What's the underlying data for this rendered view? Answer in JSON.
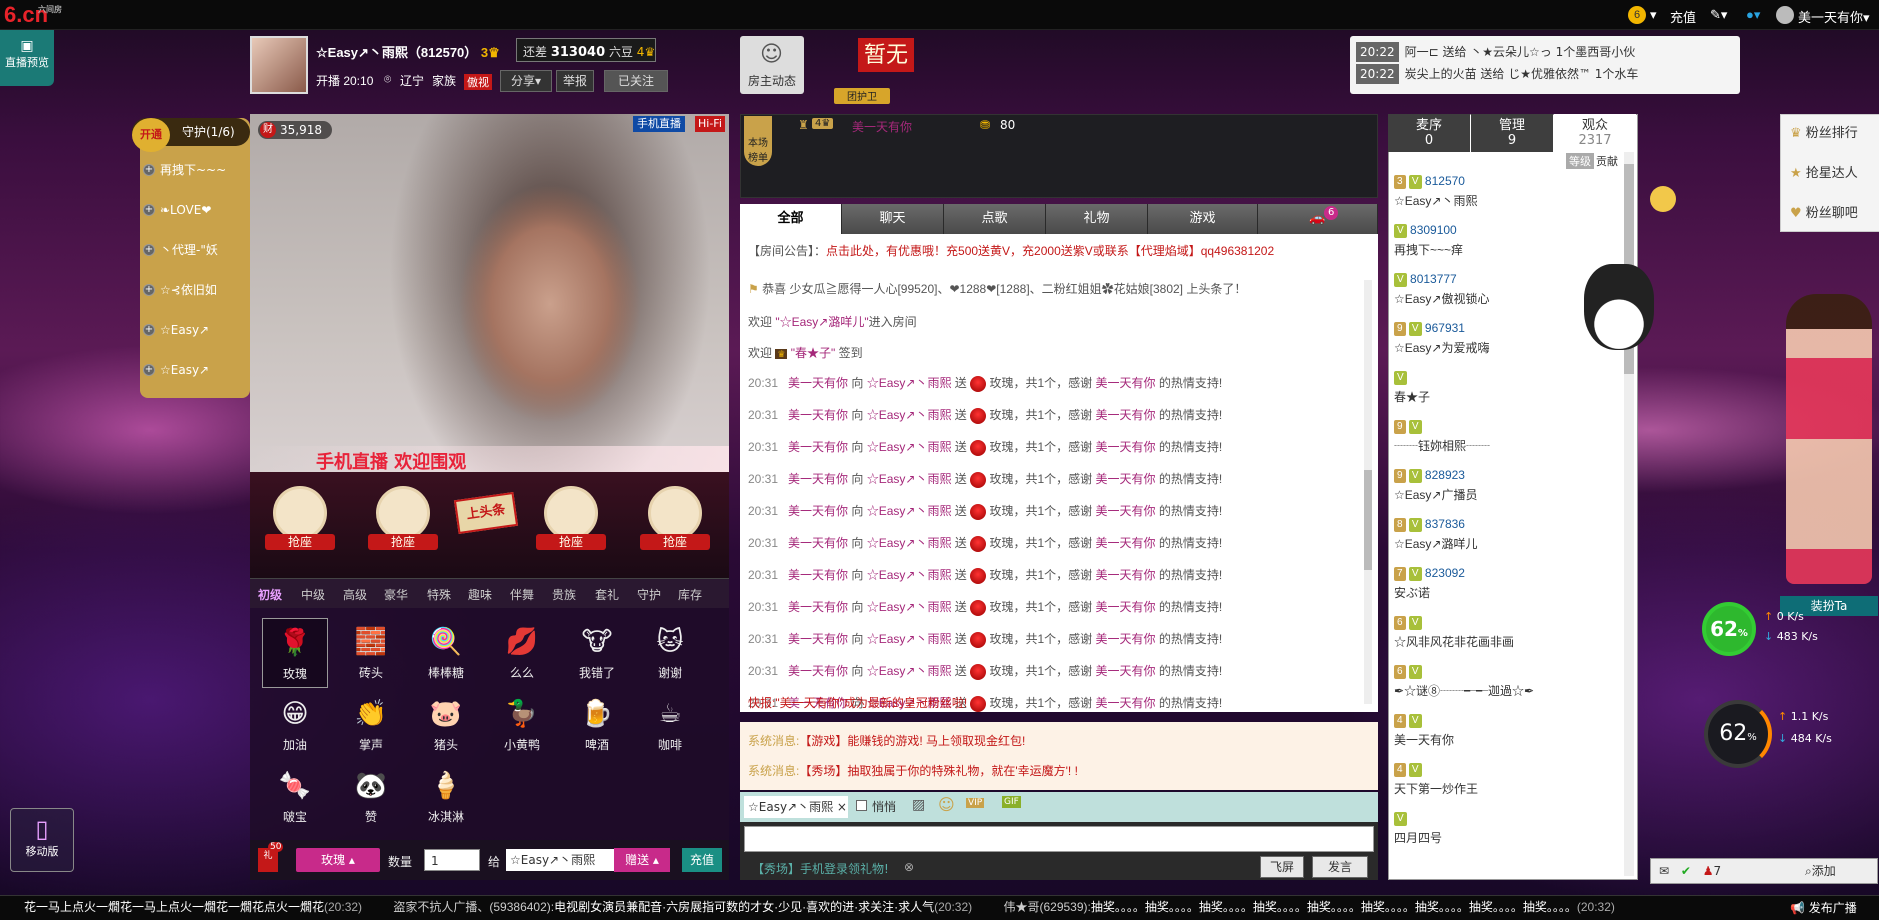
{
  "topbar": {
    "logo": "6.cn",
    "logo_sub": "六间房",
    "recharge": "充值",
    "username": "美一天有你"
  },
  "preview": {
    "label": "直播预览"
  },
  "host": {
    "name": "☆Easy↗丶雨熙（812570）",
    "level_icon": "3",
    "gap_text": "还差",
    "gap_value": "313040",
    "gap_unit": "六豆",
    "gap_next": "4",
    "start_time": "开播 20:10",
    "location": "辽宁",
    "family_label": "家族",
    "family_badge": "傲视",
    "share": "分享",
    "report": "举报",
    "followed": "已关注",
    "home": "房主动态",
    "no_fan": "暂无",
    "guard_label": "团护卫"
  },
  "giftfeed": [
    {
      "time": "20:22",
      "text": "阿一⊏ 送给 丶★云朵儿☆っ 1个墨西哥小伙"
    },
    {
      "time": "20:22",
      "text": "炭尖上的火苗 送给 じ★优雅依然™ 1个水车"
    }
  ],
  "guard": {
    "open": "开通",
    "title": "守护(1/6)",
    "items": [
      "再拽下~~~",
      "❧LOVE❤",
      "丶代理-\"妖",
      "☆⊰依旧如",
      "☆Easy↗",
      "☆Easy↗"
    ]
  },
  "video": {
    "fans": "35,918",
    "phone_live": "手机直播",
    "hifi": "Hi-Fi",
    "banner": "手机直播 欢迎围观"
  },
  "seats": {
    "label": "抢座",
    "toppost": "上头条"
  },
  "gift_tabs": [
    "初级",
    "中级",
    "高级",
    "豪华",
    "特殊",
    "趣味",
    "伴舞",
    "贵族",
    "套礼",
    "守护",
    "库存"
  ],
  "gifts": [
    {
      "name": "玫瑰",
      "icon": "🌹"
    },
    {
      "name": "砖头",
      "icon": "🧱"
    },
    {
      "name": "棒棒糖",
      "icon": "🍭"
    },
    {
      "name": "么么",
      "icon": "💋"
    },
    {
      "name": "我错了",
      "icon": "🐮"
    },
    {
      "name": "谢谢",
      "icon": "🐱"
    },
    {
      "name": "加油",
      "icon": "😁"
    },
    {
      "name": "掌声",
      "icon": "👏"
    },
    {
      "name": "猪头",
      "icon": "🐷"
    },
    {
      "name": "小黄鸭",
      "icon": "🦆"
    },
    {
      "name": "啤酒",
      "icon": "🍺"
    },
    {
      "name": "咖啡",
      "icon": "☕"
    },
    {
      "name": "啵宝",
      "icon": "🍬"
    },
    {
      "name": "赞",
      "icon": "🐼"
    },
    {
      "name": "冰淇淋",
      "icon": "🍦"
    }
  ],
  "giftbar": {
    "count_badge": "50",
    "gift": "玫瑰",
    "qty_label": "数量",
    "qty": "1",
    "to_label": "给",
    "to_user": "☆Easy↗丶雨熙",
    "send": "赠送",
    "recharge": "充值"
  },
  "chat_top": {
    "title": "本场榜单",
    "user": "美一天有你",
    "level": "4",
    "score": "80"
  },
  "chat_tabs": [
    "全部",
    "聊天",
    "点歌",
    "礼物",
    "游戏"
  ],
  "car_count": "6",
  "chat": {
    "notice_label": "【房间公告】：",
    "notice": "点击此处，有优惠哦！充500送黄V，充2000送紫V或联系【代理焰域】qq496381202",
    "headline": "恭喜 少女瓜≧愿得一人心[99520]、❤1288❤[1288]、二粉红姐姐✿花姑娘[3802] 上头条了！",
    "welcome1_a": "欢迎 ",
    "welcome1_u": "\"☆Easy↗潞咩儿\"",
    "welcome1_b": "进入房间",
    "welcome2_a": "欢迎 ",
    "welcome2_u": "\"春★子\"",
    "welcome2_b": " 签到",
    "gift_lines": [
      {
        "time": "20:31"
      },
      {
        "time": "20:31"
      },
      {
        "time": "20:31"
      },
      {
        "time": "20:31"
      },
      {
        "time": "20:31"
      },
      {
        "time": "20:31"
      },
      {
        "time": "20:31"
      },
      {
        "time": "20:31"
      },
      {
        "time": "20:31"
      },
      {
        "time": "20:31"
      },
      {
        "time": "20:31"
      },
      {
        "time": "20:31"
      },
      {
        "time": "20:31"
      }
    ],
    "gift_sender": "美一天有你",
    "gift_to": " 向 ",
    "gift_target": "☆Easy↗丶雨熙",
    "gift_send": " 送",
    "gift_tail": "玫瑰，共1个，感谢 ",
    "gift_thank": "美一天有你",
    "gift_end": " 的热情支持!",
    "fast": "快报:\"美一天有你\"成为最新的皇冠粉丝啦!"
  },
  "sys": [
    {
      "label": "系统消息:",
      "text": "【游戏】能赚钱的游戏! 马上领取现金红包!"
    },
    {
      "label": "系统消息:",
      "text": "【秀场】抽取独属于你的特殊礼物，就在'幸运魔方'! !"
    }
  ],
  "input": {
    "to": "☆Easy↗丶雨熙",
    "whisper": "悄悄",
    "tip": "【秀场】手机登录领礼物!",
    "fly": "飞屏",
    "send": "发言"
  },
  "aud_tabs": [
    {
      "name": "麦序",
      "count": "0"
    },
    {
      "name": "管理",
      "count": "9"
    },
    {
      "name": "观众",
      "count": "2317"
    }
  ],
  "aud_sort": [
    "等级",
    "贡献"
  ],
  "audience": [
    {
      "lv": "3",
      "id": "812570",
      "name": "☆Easy↗丶雨熙"
    },
    {
      "lv": "",
      "id": "8309100",
      "name": "再拽下~~~痒"
    },
    {
      "lv": "",
      "id": "8013777",
      "name": "☆Easy↗傲视锁心"
    },
    {
      "lv": "9",
      "id": "967931",
      "name": "☆Easy↗为爱戒嗨"
    },
    {
      "lv": "",
      "id": "",
      "name": "春★子"
    },
    {
      "lv": "9",
      "id": "",
      "name": "┈┈钰妳相熙┈┈"
    },
    {
      "lv": "9",
      "id": "828923",
      "name": "☆Easy↗广播员"
    },
    {
      "lv": "8",
      "id": "837836",
      "name": "☆Easy↗潞咩儿"
    },
    {
      "lv": "7",
      "id": "823092",
      "name": "安ぶ诺"
    },
    {
      "lv": "6",
      "id": "",
      "name": "☆风非风花非花画非画"
    },
    {
      "lv": "6",
      "id": "",
      "name": "✒☆谜⑧┈┈╾╾迦過☆✒"
    },
    {
      "lv": "4",
      "id": "",
      "name": "美一天有你"
    },
    {
      "lv": "4",
      "id": "",
      "name": "天下第一炒作王"
    },
    {
      "lv": "",
      "id": "",
      "name": "四月四号"
    }
  ],
  "rside": [
    "粉丝排行",
    "抢星达人",
    "粉丝聊吧"
  ],
  "dress": "装扮Ta",
  "speed1": {
    "pct": "62",
    "up": "0",
    "down": "483",
    "unit": "K/s"
  },
  "speed2": {
    "pct": "62",
    "up": "1.1",
    "down": "484",
    "unit": "K/s"
  },
  "bottom": {
    "t1": "花一马上点火一燗花一马上点火一燗花一燗花点火一燗花",
    "t1_time": "(20:32)",
    "t2_user": "盗家不抗人广播、(59386402):",
    "t2": "电视剧女演员兼配音·六房展指可数的才女·少见·喜欢的进·求关注·求人气",
    "t2_time": "(20:32)",
    "t3_user": "伟★哥(629539):",
    "t3": "抽奖。。。。抽奖。。。。抽奖。。。。抽奖。。。。抽奖。。。。抽奖。。。。抽奖。。。。抽奖。。。。抽奖。。。。",
    "t3_time": "(20:32)",
    "broadcast": "发布广播"
  },
  "mobile": "移动版",
  "zoom": {
    "count": "7",
    "add": "添加"
  }
}
